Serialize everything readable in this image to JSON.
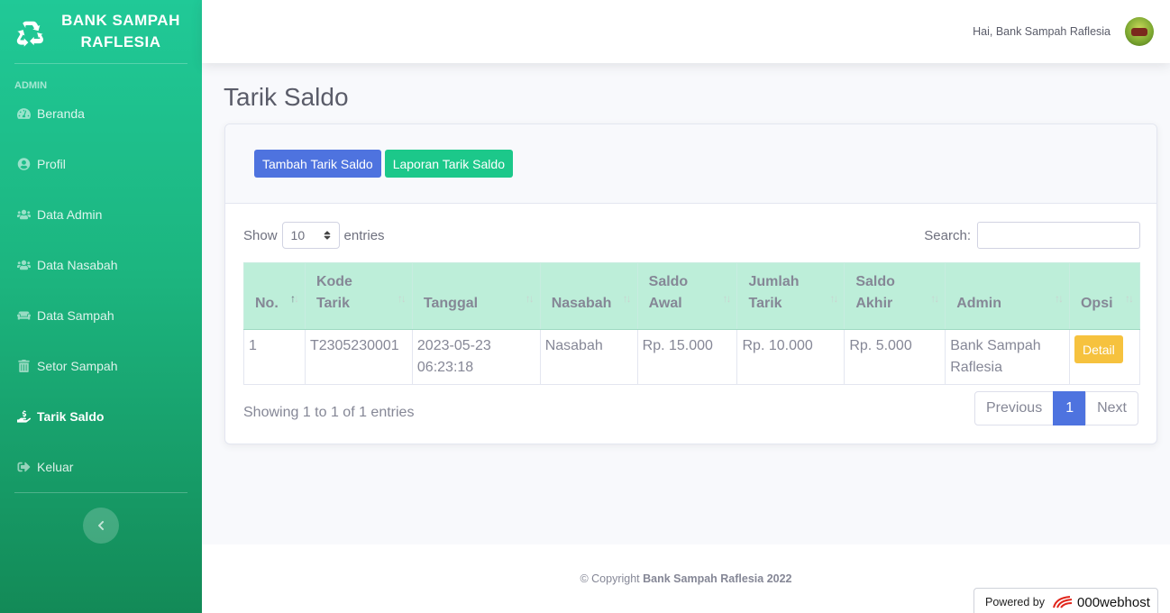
{
  "brand": {
    "line1": "BANK SAMPAH",
    "line2": "RAFLESIA",
    "icon": "recycle-icon"
  },
  "sidebar": {
    "heading": "ADMIN",
    "items": [
      {
        "label": "Beranda",
        "icon": "dashboard-icon",
        "active": false
      },
      {
        "label": "Profil",
        "icon": "user-circle-icon",
        "active": false
      },
      {
        "label": "Data Admin",
        "icon": "users-icon",
        "active": false
      },
      {
        "label": "Data Nasabah",
        "icon": "users-group-icon",
        "active": false
      },
      {
        "label": "Data Sampah",
        "icon": "couch-icon",
        "active": false
      },
      {
        "label": "Setor Sampah",
        "icon": "trash-icon",
        "active": false
      },
      {
        "label": "Tarik Saldo",
        "icon": "hand-holding-icon",
        "active": true
      },
      {
        "label": "Keluar",
        "icon": "sign-out-icon",
        "active": false
      }
    ]
  },
  "topbar": {
    "greeting": "Hai, Bank Sampah Raflesia"
  },
  "page": {
    "title": "Tarik Saldo"
  },
  "actions": {
    "add_label": "Tambah Tarik Saldo",
    "report_label": "Laporan Tarik Saldo"
  },
  "datatable": {
    "show_label": "Show",
    "entries_value": "10",
    "entries_label": "entries",
    "search_label": "Search:",
    "search_value": "",
    "columns": [
      {
        "line1": "No.",
        "line2": ""
      },
      {
        "line1": "Kode",
        "line2": "Tarik"
      },
      {
        "line1": "Tanggal",
        "line2": ""
      },
      {
        "line1": "Nasabah",
        "line2": ""
      },
      {
        "line1": "Saldo",
        "line2": "Awal"
      },
      {
        "line1": "Jumlah",
        "line2": "Tarik"
      },
      {
        "line1": "Saldo",
        "line2": "Akhir"
      },
      {
        "line1": "Admin",
        "line2": ""
      },
      {
        "line1": "Opsi",
        "line2": ""
      }
    ],
    "rows": [
      {
        "no": "1",
        "kode": "T2305230001",
        "tanggal_date": "2023-05-23",
        "tanggal_time": "06:23:18",
        "nasabah": "Nasabah",
        "saldo_awal": "Rp. 15.000",
        "jumlah_tarik": "Rp. 10.000",
        "saldo_akhir": "Rp. 5.000",
        "admin_line1": "Bank Sampah",
        "admin_line2": "Raflesia",
        "opsi_label": "Detail"
      }
    ],
    "info": "Showing 1 to 1 of 1 entries",
    "pagination": {
      "previous": "Previous",
      "current": "1",
      "next": "Next"
    }
  },
  "footer": {
    "copyright_prefix": "© Copyright",
    "copyright_bold": "Bank Sampah Raflesia 2022"
  },
  "powered": {
    "label": "Powered by",
    "host": "000webhost"
  },
  "colors": {
    "primary": "#4e73df",
    "success": "#1cc88a",
    "warning": "#f6c23e",
    "header_bg": "#bdeed9",
    "sidebar_top": "#20c997",
    "sidebar_bottom": "#138a57"
  }
}
